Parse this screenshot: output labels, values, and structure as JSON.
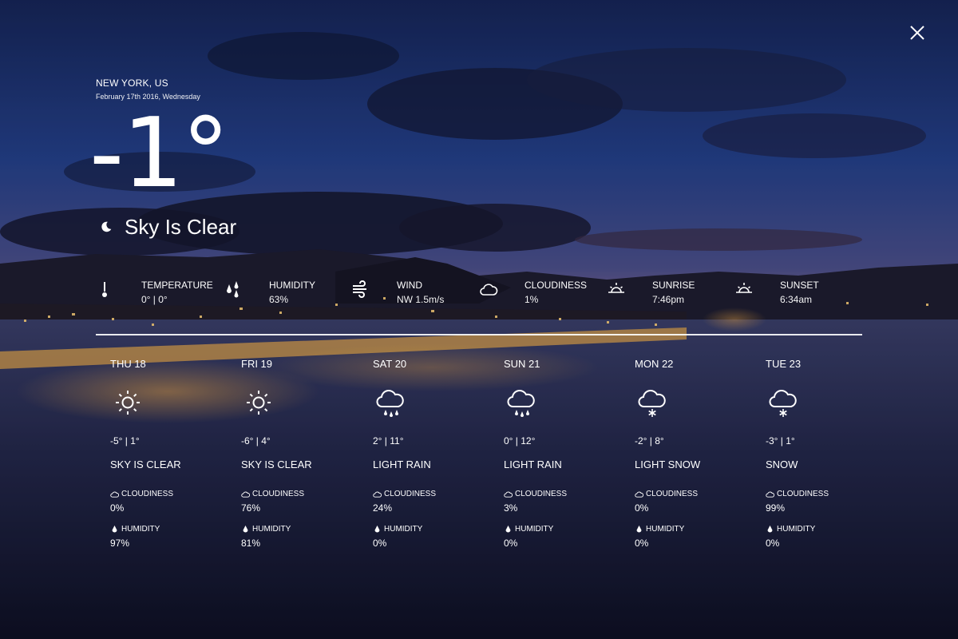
{
  "location": "NEW YORK, US",
  "date": "February 17th 2016, Wednesday",
  "current": {
    "temperature": "-1",
    "degree_symbol": "°",
    "condition": "Sky Is Clear",
    "condition_icon": "moon-icon"
  },
  "stats": [
    {
      "label": "TEMPERATURE",
      "value": "0° | 0°",
      "icon": "thermometer-icon"
    },
    {
      "label": "HUMIDITY",
      "value": "63%",
      "icon": "raindrops-icon"
    },
    {
      "label": "WIND",
      "value": "NW 1.5m/s",
      "icon": "wind-icon"
    },
    {
      "label": "CLOUDINESS",
      "value": "1%",
      "icon": "cloud-icon"
    },
    {
      "label": "SUNRISE",
      "value": "7:46pm",
      "icon": "sunrise-icon"
    },
    {
      "label": "SUNSET",
      "value": "6:34am",
      "icon": "sunset-icon"
    }
  ],
  "forecast": [
    {
      "day": "THU 18",
      "range": "-5° | 1°",
      "condition": "SKY IS CLEAR",
      "icon": "sun-icon",
      "cloudiness_label": "CLOUDINESS",
      "cloudiness": "0%",
      "humidity_label": "HUMIDITY",
      "humidity": "97%"
    },
    {
      "day": "FRI 19",
      "range": "-6° | 4°",
      "condition": "SKY IS CLEAR",
      "icon": "sun-icon",
      "cloudiness_label": "CLOUDINESS",
      "cloudiness": "76%",
      "humidity_label": "HUMIDITY",
      "humidity": "81%"
    },
    {
      "day": "SAT 20",
      "range": "2° | 11°",
      "condition": "LIGHT RAIN",
      "icon": "rain-cloud-icon",
      "cloudiness_label": "CLOUDINESS",
      "cloudiness": "24%",
      "humidity_label": "HUMIDITY",
      "humidity": "0%"
    },
    {
      "day": "SUN 21",
      "range": "0° | 12°",
      "condition": "LIGHT RAIN",
      "icon": "rain-cloud-icon",
      "cloudiness_label": "CLOUDINESS",
      "cloudiness": "3%",
      "humidity_label": "HUMIDITY",
      "humidity": "0%"
    },
    {
      "day": "MON 22",
      "range": "-2° | 8°",
      "condition": "LIGHT SNOW",
      "icon": "snow-cloud-icon",
      "cloudiness_label": "CLOUDINESS",
      "cloudiness": "0%",
      "humidity_label": "HUMIDITY",
      "humidity": "0%"
    },
    {
      "day": "TUE 23",
      "range": "-3° | 1°",
      "condition": "SNOW",
      "icon": "snow-cloud-icon",
      "cloudiness_label": "CLOUDINESS",
      "cloudiness": "99%",
      "humidity_label": "HUMIDITY",
      "humidity": "0%"
    }
  ],
  "colors": {
    "sky_top": "#1a2a66",
    "sky_horizon": "#c07a8e",
    "water": "#1b1f3c",
    "city_lights": "#f2b13a"
  }
}
